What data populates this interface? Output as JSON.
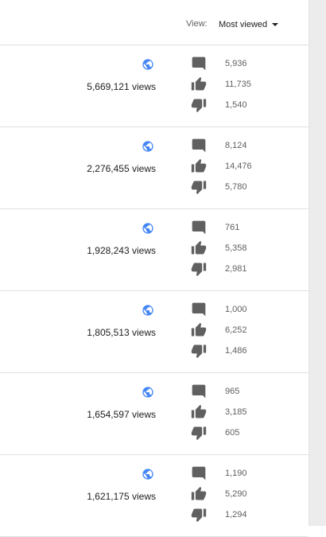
{
  "header": {
    "view_label": "View:",
    "sort_selected": "Most viewed"
  },
  "colors": {
    "globe": "#4285f4",
    "icon": "#606060",
    "divider": "#e0e0e0"
  },
  "rows": [
    {
      "views": "5,669,121 views",
      "comments": "5,936",
      "likes": "11,735",
      "dislikes": "1,540"
    },
    {
      "views": "2,276,455 views",
      "comments": "8,124",
      "likes": "14,476",
      "dislikes": "5,780"
    },
    {
      "views": "1,928,243 views",
      "comments": "761",
      "likes": "5,358",
      "dislikes": "2,981"
    },
    {
      "views": "1,805,513 views",
      "comments": "1,000",
      "likes": "6,252",
      "dislikes": "1,486"
    },
    {
      "views": "1,654,597 views",
      "comments": "965",
      "likes": "3,185",
      "dislikes": "605"
    },
    {
      "views": "1,621,175 views",
      "comments": "1,190",
      "likes": "5,290",
      "dislikes": "1,294"
    }
  ]
}
